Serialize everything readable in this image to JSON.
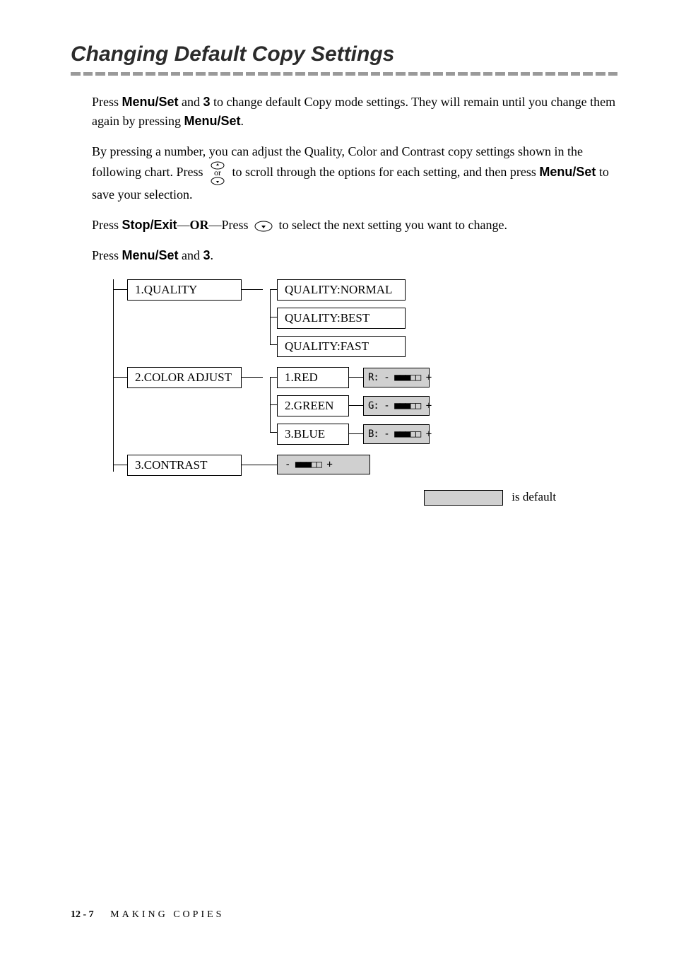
{
  "heading": "Changing Default Copy Settings",
  "intro": {
    "p1_pre": "Press ",
    "p1_b1": "Menu/Set",
    "p1_mid1": " and ",
    "p1_b2": "3",
    "p1_mid2": " to change default Copy mode settings. They will remain until you change them again by pressing ",
    "p1_b3": "Menu/Set",
    "p1_end": "."
  },
  "p2": {
    "pre": "By pressing a number, you can adjust the Quality, Color and Contrast copy settings shown in the following chart. Press ",
    "icon_label": "or",
    "mid": " to scroll through the options for each setting, and then press ",
    "b1": "Menu/Set",
    "end": " to save your selection."
  },
  "p3": {
    "pre": "Press ",
    "b1": "Stop/Exit",
    "mid1": "—",
    "b2": "OR",
    "mid2": "—Press ",
    "end": " to select the next setting you want to change."
  },
  "p4": {
    "pre": "Press ",
    "b1": "Menu/Set",
    "mid": " and ",
    "b2": "3",
    "end": "."
  },
  "tree": {
    "quality": {
      "label": "1.QUALITY",
      "options": [
        "QUALITY:NORMAL",
        "QUALITY:BEST",
        "QUALITY:FAST"
      ]
    },
    "color": {
      "label": "2.COLOR ADJUST",
      "items": [
        {
          "label": "1.RED",
          "value": "R: - ■■■□□ +"
        },
        {
          "label": "2.GREEN",
          "value": "G: - ■■■□□ +"
        },
        {
          "label": "3.BLUE",
          "value": "B: - ■■■□□ +"
        }
      ]
    },
    "contrast": {
      "label": "3.CONTRAST",
      "value": "- ■■■□□ +"
    }
  },
  "legend": "is default",
  "footer": {
    "page": "12 - 7",
    "title": "MAKING COPIES"
  }
}
